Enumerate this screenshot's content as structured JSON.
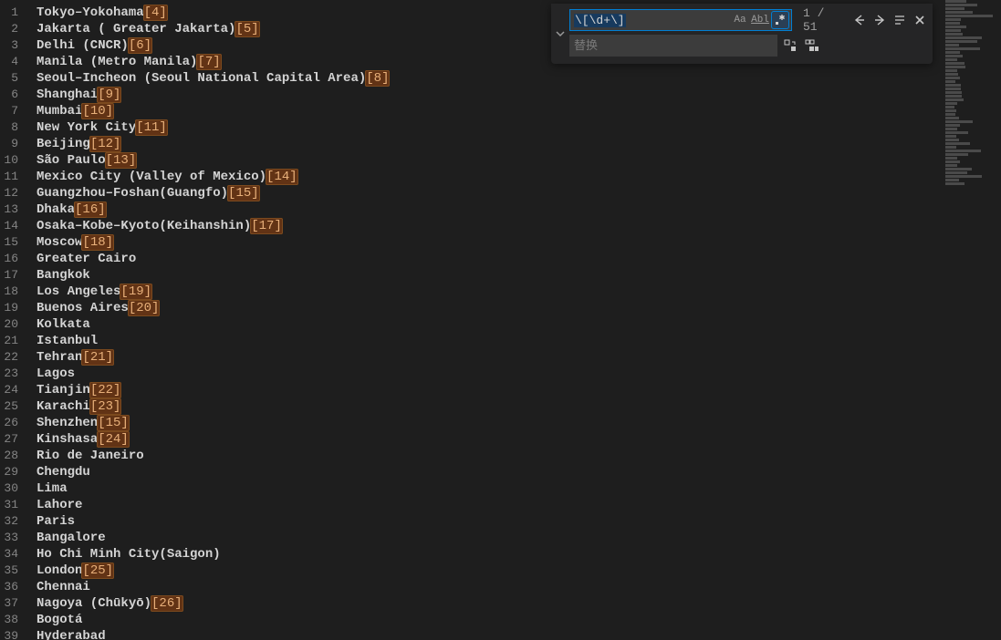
{
  "find": {
    "value": "\\[\\d+\\]",
    "replace_placeholder": "替换",
    "result_current": 1,
    "result_separator": " / ",
    "result_total": 51,
    "options": {
      "case_sensitive": false,
      "whole_word": false,
      "regex": true
    }
  },
  "lines": [
    {
      "n": 1,
      "text": "Tokyo–Yokohama",
      "ref": "[4]"
    },
    {
      "n": 2,
      "text": "Jakarta ( Greater Jakarta)",
      "ref": "[5]"
    },
    {
      "n": 3,
      "text": "Delhi (CNCR)",
      "ref": "[6]"
    },
    {
      "n": 4,
      "text": "Manila (Metro Manila)",
      "ref": "[7]"
    },
    {
      "n": 5,
      "text": "Seoul–Incheon (Seoul National Capital Area)",
      "ref": "[8]"
    },
    {
      "n": 6,
      "text": "Shanghai",
      "ref": "[9]"
    },
    {
      "n": 7,
      "text": "Mumbai",
      "ref": "[10]"
    },
    {
      "n": 8,
      "text": "New York City",
      "ref": "[11]"
    },
    {
      "n": 9,
      "text": "Beijing",
      "ref": "[12]"
    },
    {
      "n": 10,
      "text": "São Paulo",
      "ref": "[13]"
    },
    {
      "n": 11,
      "text": "Mexico City (Valley of Mexico)",
      "ref": "[14]"
    },
    {
      "n": 12,
      "text": "Guangzhou–Foshan(Guangfo)",
      "ref": "[15]"
    },
    {
      "n": 13,
      "text": "Dhaka",
      "ref": "[16]"
    },
    {
      "n": 14,
      "text": "Osaka–Kobe–Kyoto(Keihanshin)",
      "ref": "[17]"
    },
    {
      "n": 15,
      "text": "Moscow",
      "ref": "[18]"
    },
    {
      "n": 16,
      "text": "Greater Cairo",
      "ref": ""
    },
    {
      "n": 17,
      "text": "Bangkok",
      "ref": ""
    },
    {
      "n": 18,
      "text": "Los Angeles",
      "ref": "[19]"
    },
    {
      "n": 19,
      "text": "Buenos Aires",
      "ref": "[20]"
    },
    {
      "n": 20,
      "text": "Kolkata",
      "ref": ""
    },
    {
      "n": 21,
      "text": "Istanbul",
      "ref": ""
    },
    {
      "n": 22,
      "text": "Tehran",
      "ref": "[21]"
    },
    {
      "n": 23,
      "text": "Lagos",
      "ref": ""
    },
    {
      "n": 24,
      "text": "Tianjin",
      "ref": "[22]"
    },
    {
      "n": 25,
      "text": "Karachi",
      "ref": "[23]"
    },
    {
      "n": 26,
      "text": "Shenzhen",
      "ref": "[15]"
    },
    {
      "n": 27,
      "text": "Kinshasa",
      "ref": "[24]"
    },
    {
      "n": 28,
      "text": "Rio de Janeiro",
      "ref": ""
    },
    {
      "n": 29,
      "text": "Chengdu",
      "ref": ""
    },
    {
      "n": 30,
      "text": "Lima",
      "ref": ""
    },
    {
      "n": 31,
      "text": "Lahore",
      "ref": ""
    },
    {
      "n": 32,
      "text": "Paris",
      "ref": ""
    },
    {
      "n": 33,
      "text": "Bangalore",
      "ref": ""
    },
    {
      "n": 34,
      "text": "Ho Chi Minh City(Saigon)",
      "ref": ""
    },
    {
      "n": 35,
      "text": "London",
      "ref": "[25]"
    },
    {
      "n": 36,
      "text": "Chennai",
      "ref": ""
    },
    {
      "n": 37,
      "text": "Nagoya (Chūkyō)",
      "ref": "[26]"
    },
    {
      "n": 38,
      "text": "Bogotá",
      "ref": ""
    },
    {
      "n": 39,
      "text": "Hyderabad",
      "ref": ""
    }
  ]
}
